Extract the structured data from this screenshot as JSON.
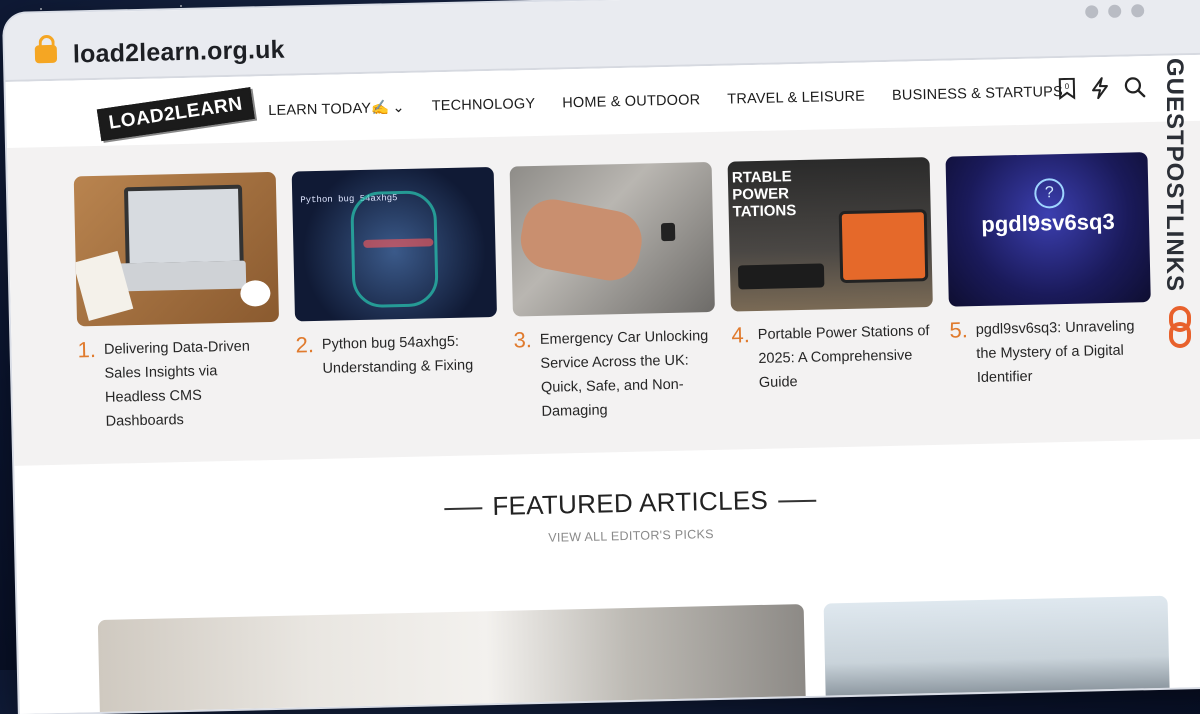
{
  "browser": {
    "url": "load2learn.org.uk"
  },
  "site": {
    "logo_text": "LOAD2LEARN",
    "nav": [
      {
        "label": "LEARN TODAY✍️",
        "has_dropdown": true
      },
      {
        "label": "TECHNOLOGY"
      },
      {
        "label": "HOME & OUTDOOR"
      },
      {
        "label": "TRAVEL & LEISURE"
      },
      {
        "label": "BUSINESS & STARTUPS"
      }
    ],
    "icons": [
      "bookmark-icon",
      "bolt-icon",
      "search-icon"
    ],
    "bookmark_count": "0"
  },
  "trending": [
    {
      "num": "1.",
      "title": "Delivering Data-Driven Sales Insights via Headless CMS Dashboards",
      "thumb": "laptop on wooden desk"
    },
    {
      "num": "2.",
      "title": "Python bug 54axhg5: Understanding & Fixing",
      "thumb_text": "Python bug 54axhg5"
    },
    {
      "num": "3.",
      "title": "Emergency Car Unlocking Service Across the UK: Quick, Safe, and Non-Damaging",
      "thumb": "hands unlocking car door"
    },
    {
      "num": "4.",
      "title": "Portable Power Stations of 2025: A Comprehensive Guide",
      "thumb_text": "RTABLE POWER TATIONS"
    },
    {
      "num": "5.",
      "title": "pgdl9sv6sq3: Unraveling the Mystery of a Digital Identifier",
      "thumb_text": "pgdl9sv6sq3"
    }
  ],
  "featured": {
    "heading": "FEATURED ARTICLES",
    "subheading": "VIEW ALL EDITOR'S PICKS"
  },
  "sidebar_brand": "GUESTPOSTLINKS",
  "colors": {
    "accent": "#e07b2e",
    "trend_bg": "#f3f2f2"
  }
}
